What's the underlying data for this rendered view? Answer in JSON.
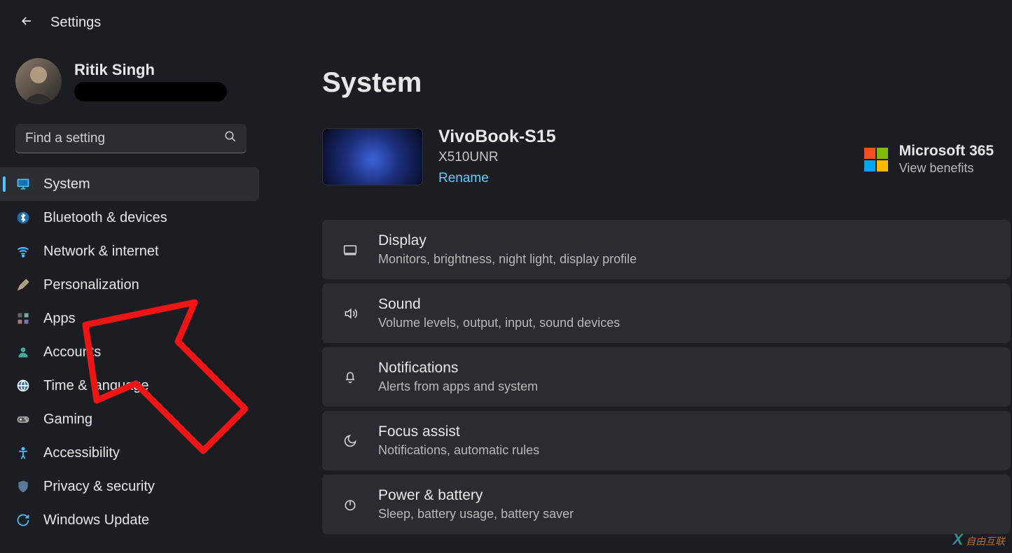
{
  "header": {
    "title": "Settings"
  },
  "user": {
    "name": "Ritik Singh"
  },
  "search": {
    "placeholder": "Find a setting"
  },
  "nav": {
    "items": [
      {
        "id": "system",
        "label": "System",
        "active": true,
        "icon": "monitor"
      },
      {
        "id": "bluetooth",
        "label": "Bluetooth & devices",
        "active": false,
        "icon": "bluetooth"
      },
      {
        "id": "network",
        "label": "Network & internet",
        "active": false,
        "icon": "wifi"
      },
      {
        "id": "personalization",
        "label": "Personalization",
        "active": false,
        "icon": "brush"
      },
      {
        "id": "apps",
        "label": "Apps",
        "active": false,
        "icon": "apps"
      },
      {
        "id": "accounts",
        "label": "Accounts",
        "active": false,
        "icon": "person"
      },
      {
        "id": "time",
        "label": "Time & language",
        "active": false,
        "icon": "globe"
      },
      {
        "id": "gaming",
        "label": "Gaming",
        "active": false,
        "icon": "gamepad"
      },
      {
        "id": "accessibility",
        "label": "Accessibility",
        "active": false,
        "icon": "accessibility"
      },
      {
        "id": "privacy",
        "label": "Privacy & security",
        "active": false,
        "icon": "shield"
      },
      {
        "id": "update",
        "label": "Windows Update",
        "active": false,
        "icon": "update"
      }
    ]
  },
  "main": {
    "title": "System",
    "device": {
      "name": "VivoBook-S15",
      "model": "X510UNR",
      "rename": "Rename"
    },
    "m365": {
      "title": "Microsoft 365",
      "sub": "View benefits"
    },
    "cards": [
      {
        "id": "display",
        "title": "Display",
        "sub": "Monitors, brightness, night light, display profile",
        "icon": "display"
      },
      {
        "id": "sound",
        "title": "Sound",
        "sub": "Volume levels, output, input, sound devices",
        "icon": "sound"
      },
      {
        "id": "notifications",
        "title": "Notifications",
        "sub": "Alerts from apps and system",
        "icon": "bell"
      },
      {
        "id": "focus",
        "title": "Focus assist",
        "sub": "Notifications, automatic rules",
        "icon": "moon"
      },
      {
        "id": "power",
        "title": "Power & battery",
        "sub": "Sleep, battery usage, battery saver",
        "icon": "power"
      }
    ]
  },
  "watermark": {
    "brand": "X",
    "text": "自由互联"
  }
}
